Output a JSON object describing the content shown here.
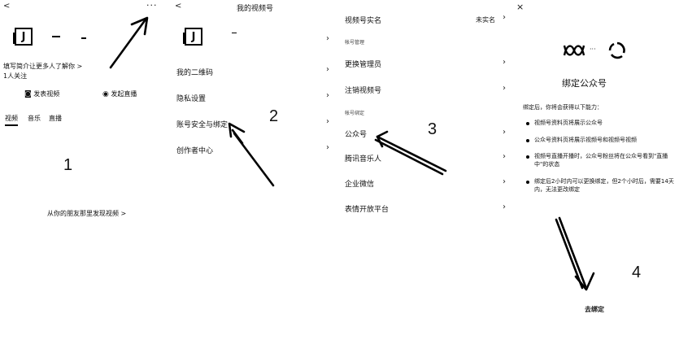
{
  "steps": [
    "1",
    "2",
    "3",
    "4"
  ],
  "panel1": {
    "more_icon": "···",
    "back_icon": "<",
    "avatar_glyph": "J",
    "intro": "填写简介让更多人了解你 >",
    "follow": "1人关注",
    "post_video": "发表视频",
    "live": "发起直播",
    "tabs": [
      "视频",
      "音乐",
      "直播"
    ],
    "footer_link": "从你的朋友那里发现视频 >"
  },
  "panel2": {
    "back_icon": "<",
    "title": "我的视频号",
    "avatar_glyph": "J",
    "items": [
      "我的二维码",
      "隐私设置",
      "账号安全与绑定",
      "创作者中心"
    ]
  },
  "panel3": {
    "top_item": "视频号实名",
    "top_value": "未实名",
    "section1": "帐号管理",
    "section1_items": [
      "更换管理员",
      "注销视频号"
    ],
    "section2": "帐号绑定",
    "section2_items": [
      "公众号",
      "腾讯音乐人",
      "企业微信",
      "表情开放平台"
    ]
  },
  "panel4": {
    "close_icon": "×",
    "logo_sep": "···",
    "title": "绑定公众号",
    "desc": "绑定后，你将会获得以下能力：",
    "bullets": [
      "视频号资料页将展示公众号",
      "公众号资料页将展示视频号和视频号视频",
      "视频号直播开播时，公众号粉丝将在公众号看到\"直播中\"的状态",
      "绑定后2小时内可以更换绑定，但2个小时后，需要14天内，无法更改绑定"
    ],
    "button": "去绑定"
  }
}
